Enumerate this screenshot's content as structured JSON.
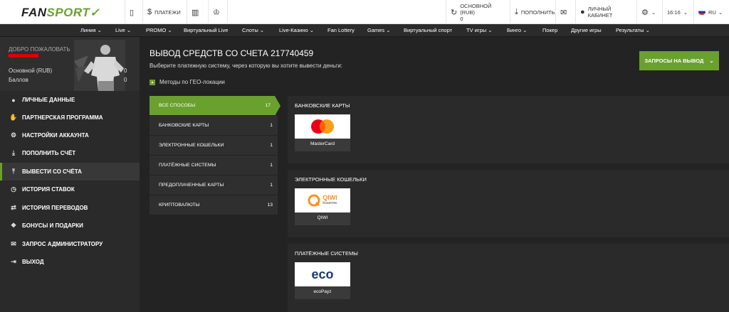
{
  "header": {
    "logo_text_1": "FAN",
    "logo_text_2": "SPORT",
    "payments": "ПЛАТЕЖИ",
    "balance_label": "ОСНОВНОЙ (RUB)",
    "balance_value": "0",
    "deposit": "ПОПОЛНИТЬ",
    "cabinet": "ЛИЧНЫЙ КАБИНЕТ",
    "time": "16:16",
    "lang": "RU"
  },
  "nav": [
    "Линия",
    "Live",
    "PROMO",
    "Виртуальный Live",
    "Слоты",
    "Live-Казино",
    "Fan Lottery",
    "Games",
    "Виртуальный спорт",
    "TV игры",
    "Бинго",
    "Покер",
    "Другие игры",
    "Результаты"
  ],
  "sidebar": {
    "welcome": "ДОБРО ПОЖАЛОВАТЬ",
    "account_main": "Основной (RUB)",
    "account_main_value": "0",
    "account_points": "Баллов",
    "account_points_value": "0",
    "items": [
      {
        "label": "ЛИЧНЫЕ ДАННЫЕ",
        "icon": "user-icon"
      },
      {
        "label": "ПАРТНЕРСКАЯ ПРОГРАММА",
        "icon": "handshake-icon"
      },
      {
        "label": "НАСТРОЙКИ АККАУНТА",
        "icon": "gear-icon"
      },
      {
        "label": "ПОПОЛНИТЬ СЧЁТ",
        "icon": "download-icon"
      },
      {
        "label": "ВЫВЕСТИ СО СЧЁТА",
        "icon": "upload-icon"
      },
      {
        "label": "ИСТОРИЯ СТАВОК",
        "icon": "clock-icon"
      },
      {
        "label": "ИСТОРИЯ ПЕРЕВОДОВ",
        "icon": "transfer-icon"
      },
      {
        "label": "БОНУСЫ И ПОДАРКИ",
        "icon": "gift-icon"
      },
      {
        "label": "ЗАПРОС АДМИНИСТРАТОРУ",
        "icon": "mail-icon"
      },
      {
        "label": "ВЫХОД",
        "icon": "logout-icon"
      }
    ]
  },
  "main": {
    "title": "ВЫВОД СРЕДСТВ СО СЧЕТА 217740459",
    "subtitle": "Выберите платежную систему, через которую вы хотите вывести деньги:",
    "requests_button": "ЗАПРОСЫ НА ВЫВОД",
    "geo_label": "Методы по ГЕО-локации",
    "categories": [
      {
        "label": "ВСЕ СПОСОБЫ",
        "count": "17"
      },
      {
        "label": "БАНКОВСКИЕ КАРТЫ",
        "count": "1"
      },
      {
        "label": "ЭЛЕКТРОННЫЕ КОШЕЛЬКИ",
        "count": "1"
      },
      {
        "label": "ПЛАТЁЖНЫЕ СИСТЕМЫ",
        "count": "1"
      },
      {
        "label": "ПРЕДОПЛАЧЕННЫЕ КАРТЫ",
        "count": "1"
      },
      {
        "label": "КРИПТОВАЛЮТЫ",
        "count": "13"
      }
    ],
    "groups": [
      {
        "title": "БАНКОВСКИЕ КАРТЫ",
        "method": "MasterCard"
      },
      {
        "title": "ЭЛЕКТРОННЫЕ КОШЕЛЬКИ",
        "method": "QIWI",
        "logo_text": "QIWI",
        "logo_sub": "Кошелек"
      },
      {
        "title": "ПЛАТЁЖНЫЕ СИСТЕМЫ",
        "method": "ecoPayz",
        "logo_text": "eco"
      }
    ]
  },
  "colors": {
    "accent": "#6aa12e",
    "bg": "#232323",
    "panel": "#2a2a2a"
  }
}
